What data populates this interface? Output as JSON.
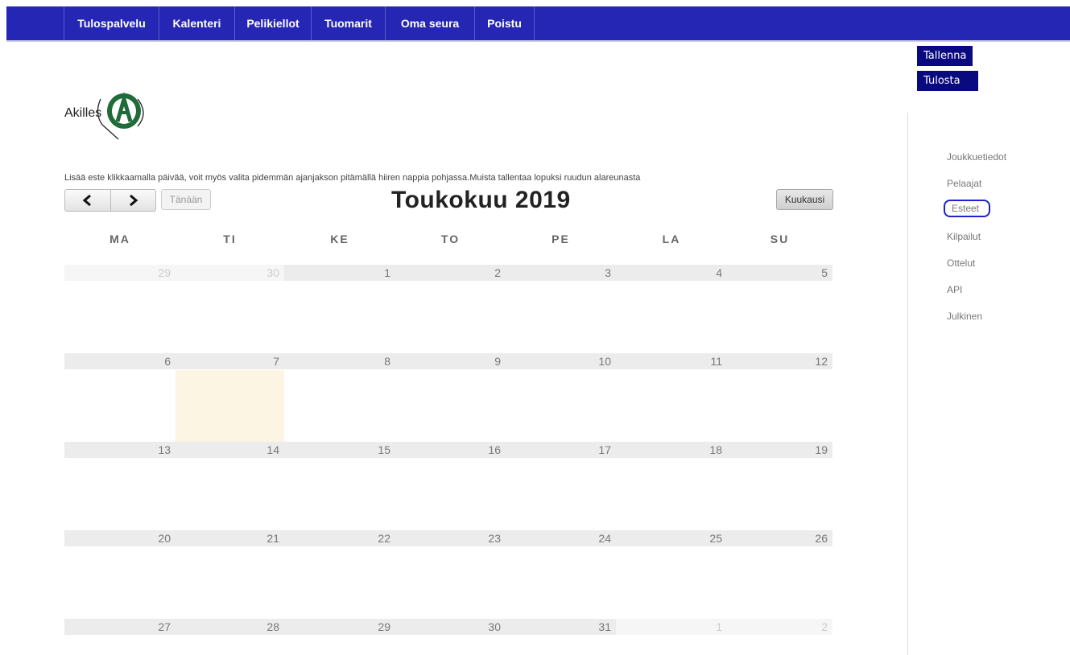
{
  "nav": {
    "items": [
      "Tulospalvelu",
      "Kalenteri",
      "Pelikiellot",
      "Tuomarit",
      "Oma seura",
      "Poistu"
    ]
  },
  "actions": {
    "save": "Tallenna",
    "print": "Tulosta"
  },
  "side_menu": {
    "items": [
      "Joukkuetiedot",
      "Pelaajat",
      "Esteet",
      "Kilpailut",
      "Ottelut",
      "API",
      "Julkinen"
    ],
    "active": "Esteet"
  },
  "club": {
    "name": "Akilles"
  },
  "instruction": "Lisää este klikkaamalla päivää, voit myös valita pidemmän ajanjakson pitämällä hiiren nappia pohjassa.Muista tallentaa lopuksi ruudun alareunasta",
  "calendar": {
    "title": "Toukokuu 2019",
    "today_button": "Tänään",
    "view_button": "Kuukausi",
    "prev_icon": "chevron-left-icon",
    "next_icon": "chevron-right-icon",
    "weekdays": [
      "MA",
      "TI",
      "KE",
      "TO",
      "PE",
      "LA",
      "SU"
    ],
    "weeks": [
      [
        "29",
        "30",
        "1",
        "2",
        "3",
        "4",
        "5"
      ],
      [
        "6",
        "7",
        "8",
        "9",
        "10",
        "11",
        "12"
      ],
      [
        "13",
        "14",
        "15",
        "16",
        "17",
        "18",
        "19"
      ],
      [
        "20",
        "21",
        "22",
        "23",
        "24",
        "25",
        "26"
      ],
      [
        "27",
        "28",
        "29",
        "30",
        "31",
        "1",
        "2"
      ]
    ],
    "other_month_cells": [
      [
        0,
        0
      ],
      [
        0,
        1
      ],
      [
        4,
        5
      ],
      [
        4,
        6
      ]
    ],
    "today_cell": [
      1,
      1
    ]
  },
  "colors": {
    "nav_bg": "#2626b4",
    "action_bg": "#0a0a80",
    "today_bg": "#fdf5e3",
    "highlight_ring": "#2020d0"
  }
}
